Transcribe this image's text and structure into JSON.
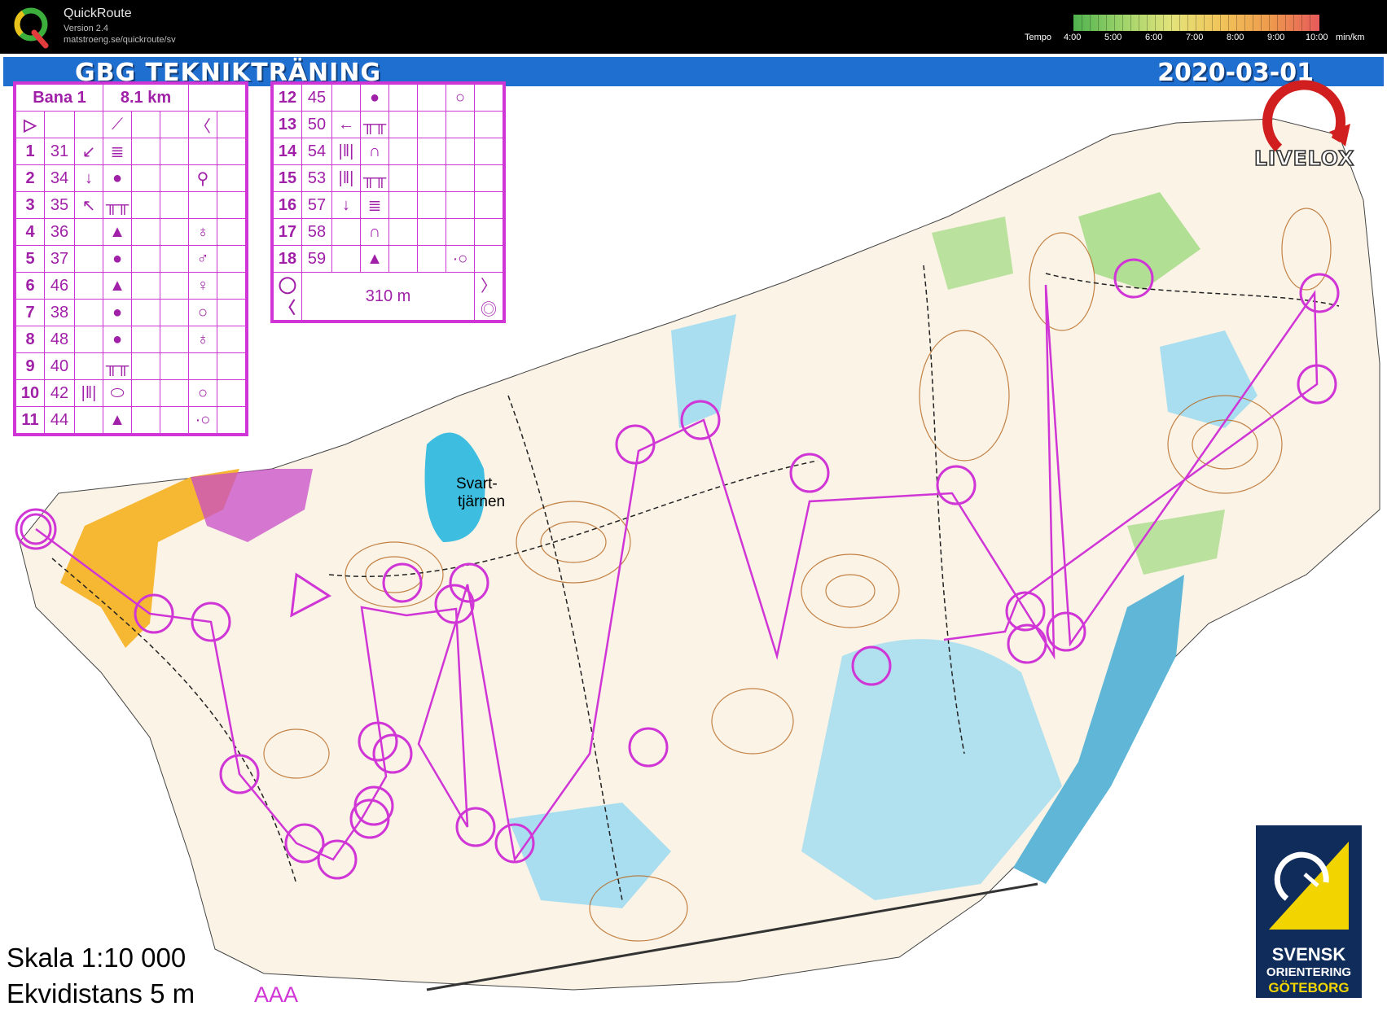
{
  "app": {
    "name": "QuickRoute",
    "version": "Version 2.4",
    "url": "matstroeng.se/quickroute/sv"
  },
  "tempo": {
    "label": "Tempo",
    "ticks": [
      "4:00",
      "5:00",
      "6:00",
      "7:00",
      "8:00",
      "9:00",
      "10:00"
    ],
    "unit": "min/km",
    "gradient_colors": [
      "#4fb14f",
      "#9ed46a",
      "#e3e37a",
      "#f1c45a",
      "#ee9a4d",
      "#e65a5a"
    ]
  },
  "map": {
    "title": "GBG TEKNIKTRÄNING",
    "date": "2020-03-01",
    "lake_label_1": "Svart-",
    "lake_label_2": "tjärnen",
    "scale": "Skala 1:10 000",
    "contour": "Ekvidistans 5 m",
    "aaa": "AAA",
    "livelox_logo": "LIVELOX",
    "sponsor": {
      "line1": "SVENSK",
      "line2": "ORIENTERING",
      "line3": "GÖTEBORG"
    },
    "colors": {
      "course": "#d036d6",
      "header_band": "#1f6fd1",
      "water": "#7fd0e6",
      "open_land": "#f6b733",
      "vegetation": "#9fd97f",
      "contour": "#b5651d"
    }
  },
  "course": {
    "name": "Bana 1",
    "length": "8.1 km",
    "controls_left": [
      {
        "num": "1",
        "code": "31",
        "c": "↙",
        "d": "≣",
        "g": ""
      },
      {
        "num": "2",
        "code": "34",
        "c": "↓",
        "d": "●",
        "g": "⚲"
      },
      {
        "num": "3",
        "code": "35",
        "c": "↖",
        "d": "╥╥",
        "g": ""
      },
      {
        "num": "4",
        "code": "36",
        "c": "",
        "d": "▲",
        "g": "♁"
      },
      {
        "num": "5",
        "code": "37",
        "c": "",
        "d": "●",
        "g": "♂"
      },
      {
        "num": "6",
        "code": "46",
        "c": "",
        "d": "▲",
        "g": "♀"
      },
      {
        "num": "7",
        "code": "38",
        "c": "",
        "d": "●",
        "g": "○"
      },
      {
        "num": "8",
        "code": "48",
        "c": "",
        "d": "●",
        "g": "♁"
      },
      {
        "num": "9",
        "code": "40",
        "c": "",
        "d": "╥╥",
        "g": ""
      },
      {
        "num": "10",
        "code": "42",
        "c": "|‖|",
        "d": "⬭",
        "g": "○"
      },
      {
        "num": "11",
        "code": "44",
        "c": "",
        "d": "▲",
        "g": "·○"
      }
    ],
    "controls_right": [
      {
        "num": "12",
        "code": "45",
        "c": "",
        "d": "●",
        "g": "○"
      },
      {
        "num": "13",
        "code": "50",
        "c": "←",
        "d": "╥╥",
        "g": ""
      },
      {
        "num": "14",
        "code": "54",
        "c": "|‖|",
        "d": "∩",
        "g": ""
      },
      {
        "num": "15",
        "code": "53",
        "c": "|‖|",
        "d": "╥╥",
        "g": ""
      },
      {
        "num": "16",
        "code": "57",
        "c": "↓",
        "d": "≣",
        "g": ""
      },
      {
        "num": "17",
        "code": "58",
        "c": "",
        "d": "∩",
        "g": ""
      },
      {
        "num": "18",
        "code": "59",
        "c": "",
        "d": "▲",
        "g": "·○"
      }
    ],
    "finish_distance": "310 m"
  }
}
